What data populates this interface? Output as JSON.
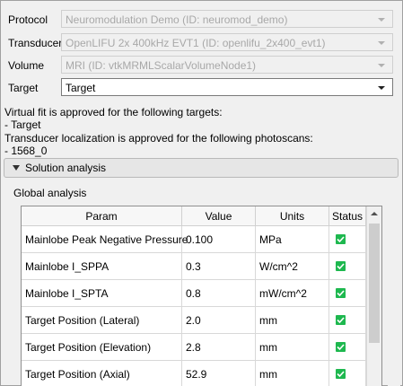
{
  "form": {
    "protocol": {
      "label": "Protocol",
      "value": "Neuromodulation Demo (ID: neuromod_demo)"
    },
    "transducer": {
      "label": "Transducer",
      "value": "OpenLIFU 2x 400kHz EVT1 (ID: openlifu_2x400_evt1)"
    },
    "volume": {
      "label": "Volume",
      "value": "MRI (ID: vtkMRMLScalarVolumeNode1)"
    },
    "target": {
      "label": "Target",
      "value": "Target"
    }
  },
  "messages": [
    "Virtual fit is approved for the following targets:",
    "- Target",
    "Transducer localization is approved for the following photoscans:",
    "- 1568_0"
  ],
  "section": {
    "label": "Solution analysis"
  },
  "global_label": "Global analysis",
  "table": {
    "headers": [
      "Param",
      "Value",
      "Units",
      "Status"
    ],
    "rows": [
      {
        "param": "Mainlobe Peak Negative Pressure",
        "value": "0.100",
        "units": "MPa",
        "status": true
      },
      {
        "param": "Mainlobe I_SPPA",
        "value": "0.3",
        "units": "W/cm^2",
        "status": true
      },
      {
        "param": "Mainlobe I_SPTA",
        "value": "0.8",
        "units": "mW/cm^2",
        "status": true
      },
      {
        "param": "Target Position (Lateral)",
        "value": "2.0",
        "units": "mm",
        "status": true
      },
      {
        "param": "Target Position (Elevation)",
        "value": "2.8",
        "units": "mm",
        "status": true
      },
      {
        "param": "Target Position (Axial)",
        "value": "52.9",
        "units": "mm",
        "status": true
      }
    ]
  },
  "colors": {
    "status_ok": "#1eb84f",
    "disabled_text": "#a8a8a8"
  },
  "icons": {
    "combo_arrow": "chevron-down-icon",
    "section_toggle": "triangle-down-icon",
    "status": "checkbox-checked-icon"
  }
}
